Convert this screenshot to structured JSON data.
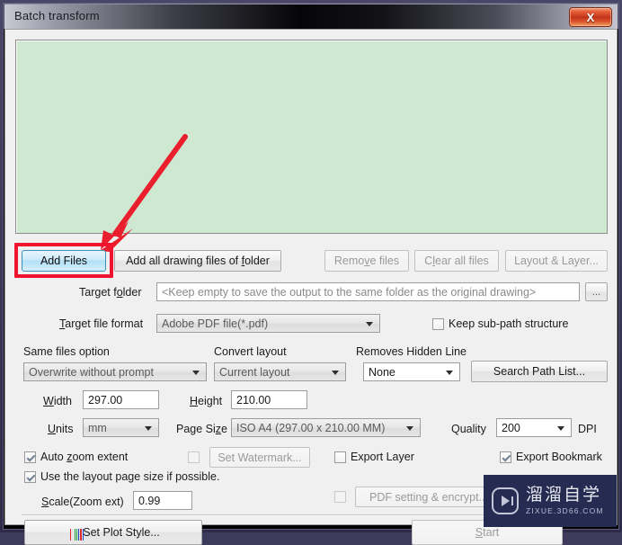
{
  "window": {
    "title": "Batch transform",
    "close_label": "X"
  },
  "file_list": {
    "items": [],
    "background_color": "#cfe8d2"
  },
  "annotation": {
    "arrow_color": "#f1142e",
    "highlight_color": "#f1142e",
    "highlight_target": "Add Files"
  },
  "toolbar": {
    "add_files": "Add Files",
    "add_all_folder_pre": "Add all drawing files of ",
    "add_all_folder_mnemonic": "f",
    "add_all_folder_post": "older",
    "remove_files_pre": "Remo",
    "remove_files_mnemonic": "v",
    "remove_files_post": "e files",
    "clear_all_pre": "C",
    "clear_all_mnemonic": "l",
    "clear_all_post": "ear all files",
    "layout_layer": "Layout & Layer..."
  },
  "target_folder": {
    "label_pre": "Target f",
    "label_mnemonic": "o",
    "label_post": "lder",
    "placeholder": "<Keep empty to save the output to the same folder as the original drawing>",
    "value": "",
    "browse_label": "..."
  },
  "target_format": {
    "label_mnemonic": "T",
    "label_post": "arget file format",
    "value": "Adobe PDF file(*.pdf)",
    "options": [
      "Adobe PDF file(*.pdf)"
    ],
    "keep_subpath_label": "Keep sub-path structure",
    "keep_subpath_checked": false
  },
  "same_files": {
    "label": "Same files option",
    "value": "Overwrite without prompt",
    "options": [
      "Overwrite without prompt"
    ]
  },
  "convert_layout": {
    "label": "Convert layout",
    "value": "Current layout",
    "options": [
      "Current layout"
    ]
  },
  "hidden_line": {
    "label": "Removes Hidden Line",
    "value": "None",
    "options": [
      "None"
    ]
  },
  "search_path": {
    "label": "Search Path List..."
  },
  "size": {
    "width_label_mnemonic": "W",
    "width_label_post": "idth",
    "width_value": "297.00",
    "height_label_mnemonic": "H",
    "height_label_post": "eight",
    "height_value": "210.00",
    "units_label_mnemonic": "U",
    "units_label_post": "nits",
    "units_value": "mm",
    "page_size_label_pre": "Page Si",
    "page_size_label_mnemonic": "z",
    "page_size_label_post": "e",
    "page_size_value": "ISO A4 (297.00 x 210.00 MM)",
    "quality_label": "Quality",
    "quality_value": "200",
    "dpi_label": "DPI"
  },
  "options": {
    "auto_zoom_pre": "Auto ",
    "auto_zoom_mnemonic": "z",
    "auto_zoom_post": "oom extent",
    "auto_zoom_checked": true,
    "watermark_label": "Set Watermark...",
    "watermark_checked": false,
    "export_layer_label": "Export Layer",
    "export_layer_checked": false,
    "export_bookmark_label": "Export Bookmark",
    "export_bookmark_checked": true,
    "use_layout_label": "Use the layout page size if possible.",
    "use_layout_checked": true,
    "scale_label_mnemonic": "S",
    "scale_label_post": "cale(Zoom ext)",
    "scale_value": "0.99",
    "pdf_setting_label": "PDF setting & encrypt...",
    "pdf_setting_checked": false
  },
  "footer": {
    "plot_style_label": "Set Plot Style...",
    "plot_style_colors": [
      "#d92b2b",
      "#e6e6e6",
      "#1f9e3c",
      "#1f9e3c",
      "#1a44c4",
      "#d92b2b",
      "#1a44c4"
    ],
    "start_pre": "",
    "start_mnemonic": "S",
    "start_post": "tart"
  },
  "watermark": {
    "cn_text": "溜溜自学",
    "en_text": "ZIXUE.3D66.COM"
  }
}
